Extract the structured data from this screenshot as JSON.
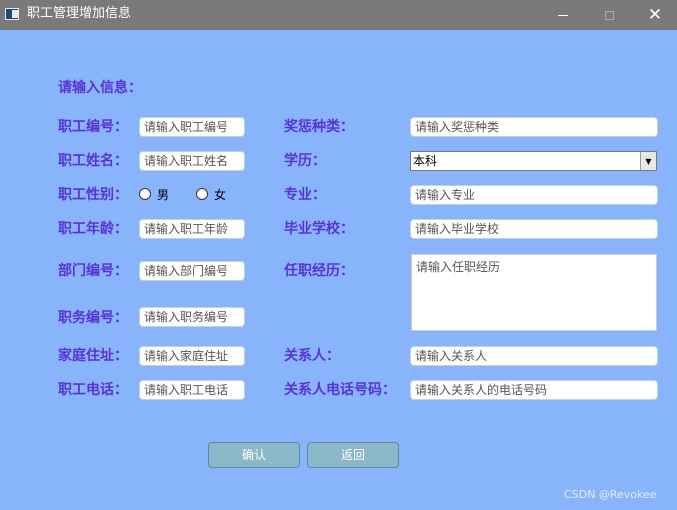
{
  "window": {
    "title": "职工管理增加信息"
  },
  "form": {
    "prompt": "请输入信息：",
    "left": {
      "emp_no": {
        "label": "职工编号：",
        "placeholder": "请输入职工编号"
      },
      "name": {
        "label": "职工姓名：",
        "placeholder": "请输入职工姓名"
      },
      "gender": {
        "label": "职工性别：",
        "options": [
          "男",
          "女"
        ]
      },
      "age": {
        "label": "职工年龄：",
        "placeholder": "请输入职工年龄"
      },
      "dept_no": {
        "label": "部门编号：",
        "placeholder": "请输入部门编号"
      },
      "job_no": {
        "label": "职务编号：",
        "placeholder": "请输入职务编号"
      },
      "address": {
        "label": "家庭住址：",
        "placeholder": "请输入家庭住址"
      },
      "phone": {
        "label": "职工电话：",
        "placeholder": "请输入职工电话"
      }
    },
    "right": {
      "reward": {
        "label": "奖惩种类：",
        "placeholder": "请输入奖惩种类"
      },
      "education": {
        "label": "学历：",
        "selected": "本科"
      },
      "major": {
        "label": "专业：",
        "placeholder": "请输入专业"
      },
      "school": {
        "label": "毕业学校：",
        "placeholder": "请输入毕业学校"
      },
      "experience": {
        "label": "任职经历：",
        "placeholder": "请输入任职经历"
      },
      "contact": {
        "label": "关系人：",
        "placeholder": "请输入关系人"
      },
      "contact_phone": {
        "label": "关系人电话号码：",
        "placeholder": "请输入关系人的电话号码"
      }
    }
  },
  "buttons": {
    "confirm": "确认",
    "back": "返回"
  },
  "watermark": "CSDN @Revokee",
  "icons": {
    "minimize": "minimize-icon",
    "maximize": "maximize-icon",
    "close": "close-icon"
  },
  "colors": {
    "background": "#88b4fb",
    "titlebar": "#7a7a7a",
    "label": "#5a33d4",
    "button": "#8ab8c8"
  }
}
